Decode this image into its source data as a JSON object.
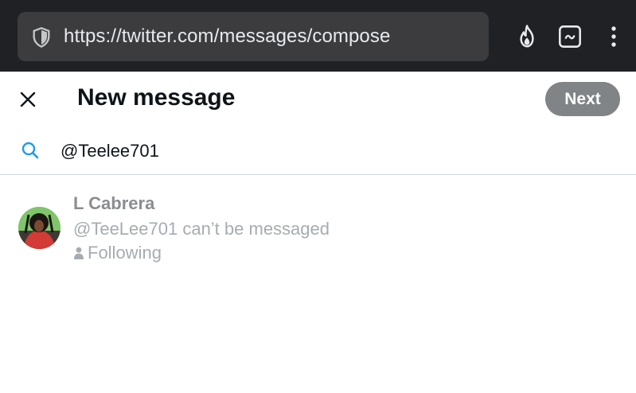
{
  "browser": {
    "url": "https://twitter.com/messages/compose",
    "icons": [
      "shield-icon",
      "fire-icon",
      "extension-icon",
      "menu-dots-icon"
    ]
  },
  "header": {
    "title": "New message",
    "next_label": "Next",
    "close_icon": "close-icon"
  },
  "search": {
    "value": "@Teelee701",
    "icon": "search-icon"
  },
  "result": {
    "name": "L Cabrera",
    "handle_status": "@TeeLee701 can’t be messaged",
    "relationship": "Following",
    "icon": "person-icon"
  },
  "colors": {
    "browser_bar": "#202124",
    "url_box": "#3c3c3f",
    "next_button": "#808487",
    "search_icon": "#1d9bf0",
    "divider": "#cfd9de"
  }
}
